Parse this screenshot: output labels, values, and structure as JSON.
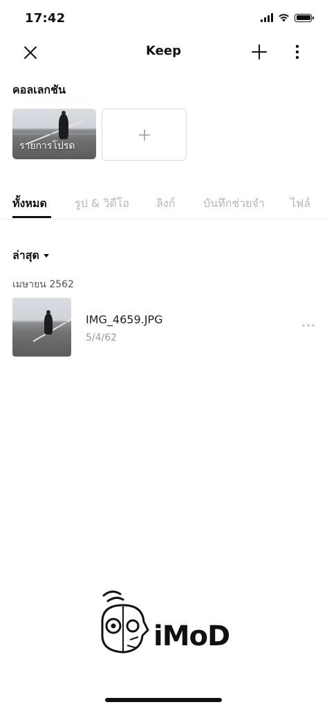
{
  "status_bar": {
    "time": "17:42"
  },
  "nav": {
    "title": "Keep"
  },
  "collections": {
    "heading": "คอลเลกชัน",
    "favorites_label": "รายการโปรด"
  },
  "tabs": [
    {
      "label": "ทั้งหมด"
    },
    {
      "label": "รูป & วิดีโอ"
    },
    {
      "label": "ลิงก์"
    },
    {
      "label": "บันทึกช่วยจำ"
    },
    {
      "label": "ไฟล์"
    }
  ],
  "sort": {
    "label": "ล่าสุด"
  },
  "groups": [
    {
      "month": "เมษายน 2562",
      "items": [
        {
          "name": "IMG_4659.JPG",
          "date": "5/4/62"
        }
      ]
    }
  ],
  "watermark": {
    "text": "iMoD"
  },
  "icons": {
    "close": "close-icon",
    "add": "plus-icon",
    "menu": "more-vertical-icon",
    "item_more": "more-horizontal-icon",
    "dropdown": "caret-down-icon"
  },
  "colors": {
    "text_primary": "#111111",
    "tab_inactive": "#b5b5b5",
    "date_text": "#9a9a9a",
    "divider": "#ececec"
  }
}
